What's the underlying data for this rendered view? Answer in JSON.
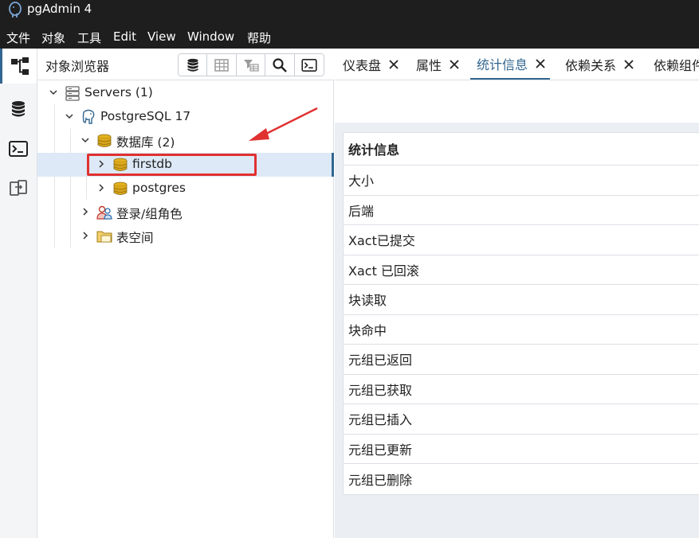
{
  "app": {
    "title": "pgAdmin 4"
  },
  "menu": [
    "文件",
    "对象",
    "工具",
    "Edit",
    "View",
    "Window",
    "帮助"
  ],
  "browser": {
    "title": "对象浏览器",
    "tree": {
      "servers": "Servers (1)",
      "server": "PostgreSQL 17",
      "databases": "数据库 (2)",
      "db1": "firstdb",
      "db2": "postgres",
      "roles": "登录/组角色",
      "tablespaces": "表空间"
    }
  },
  "tabs": [
    "仪表盘",
    "属性",
    "统计信息",
    "依赖关系",
    "依赖组件"
  ],
  "stats": {
    "header": "统计信息",
    "rows": [
      "大小",
      "后端",
      "Xact已提交",
      "Xact 已回滚",
      "块读取",
      "块命中",
      "元组已返回",
      "元组已获取",
      "元组已插入",
      "元组已更新",
      "元组已删除"
    ]
  },
  "colors": {
    "accent": "#326690",
    "annotation": "#e03131",
    "titlebar": "#1e1e1e"
  }
}
